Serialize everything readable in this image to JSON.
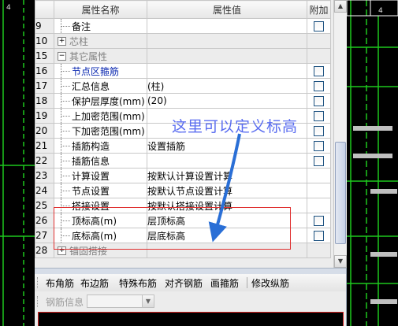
{
  "table": {
    "headers": {
      "name": "属性名称",
      "value": "属性值",
      "add": "附加"
    },
    "rows": [
      {
        "num": "9",
        "name": "备注",
        "value": "",
        "style": "plain",
        "checkbox": true
      },
      {
        "num": "10",
        "name": "芯柱",
        "value": "",
        "style": "group",
        "checkbox": false,
        "expander": "+"
      },
      {
        "num": "15",
        "name": "其它属性",
        "value": "",
        "style": "group",
        "checkbox": false,
        "expander": "−"
      },
      {
        "num": "16",
        "name": "节点区箍筋",
        "value": "",
        "style": "blue",
        "checkbox": true
      },
      {
        "num": "17",
        "name": "汇总信息",
        "value": "(柱)",
        "style": "child",
        "checkbox": true
      },
      {
        "num": "18",
        "name": "保护层厚度(mm)",
        "value": "(20)",
        "style": "child",
        "checkbox": true
      },
      {
        "num": "19",
        "name": "上加密范围(mm)",
        "value": "",
        "style": "child",
        "checkbox": true
      },
      {
        "num": "20",
        "name": "下加密范围(mm)",
        "value": "",
        "style": "child",
        "checkbox": true
      },
      {
        "num": "21",
        "name": "插筋构造",
        "value": "设置插筋",
        "style": "child",
        "checkbox": true
      },
      {
        "num": "22",
        "name": "插筋信息",
        "value": "",
        "style": "child",
        "checkbox": true
      },
      {
        "num": "23",
        "name": "计算设置",
        "value": "按默认计算设置计算",
        "style": "child",
        "checkbox": false
      },
      {
        "num": "24",
        "name": "节点设置",
        "value": "按默认节点设置计算",
        "style": "child",
        "checkbox": false
      },
      {
        "num": "25",
        "name": "搭接设置",
        "value": "按默认搭接设置计算",
        "style": "child",
        "checkbox": false
      },
      {
        "num": "26",
        "name": "顶标高(m)",
        "value": "层顶标高",
        "style": "child",
        "checkbox": true
      },
      {
        "num": "27",
        "name": "底标高(m)",
        "value": "层底标高",
        "style": "child",
        "checkbox": true
      },
      {
        "num": "28",
        "name": "锚固搭接",
        "value": "",
        "style": "group",
        "checkbox": false,
        "expander": "+"
      }
    ]
  },
  "toolbar": {
    "items": [
      "布角筋",
      "布边筋",
      "特殊布筋",
      "对齐钢筋",
      "画箍筋",
      "修改纵筋"
    ]
  },
  "rebar_info": {
    "label": "钢筋信息",
    "selected": ""
  },
  "annotation": {
    "text": "这里可以定义标高",
    "color": "#5a6df0",
    "highlight_color": "#e03030"
  },
  "colors": {
    "header_highlight": "#c00000",
    "group_text": "#808080",
    "link_text": "#0a28b0",
    "cad_background": "#000000",
    "cad_green": "#1ec81e"
  }
}
